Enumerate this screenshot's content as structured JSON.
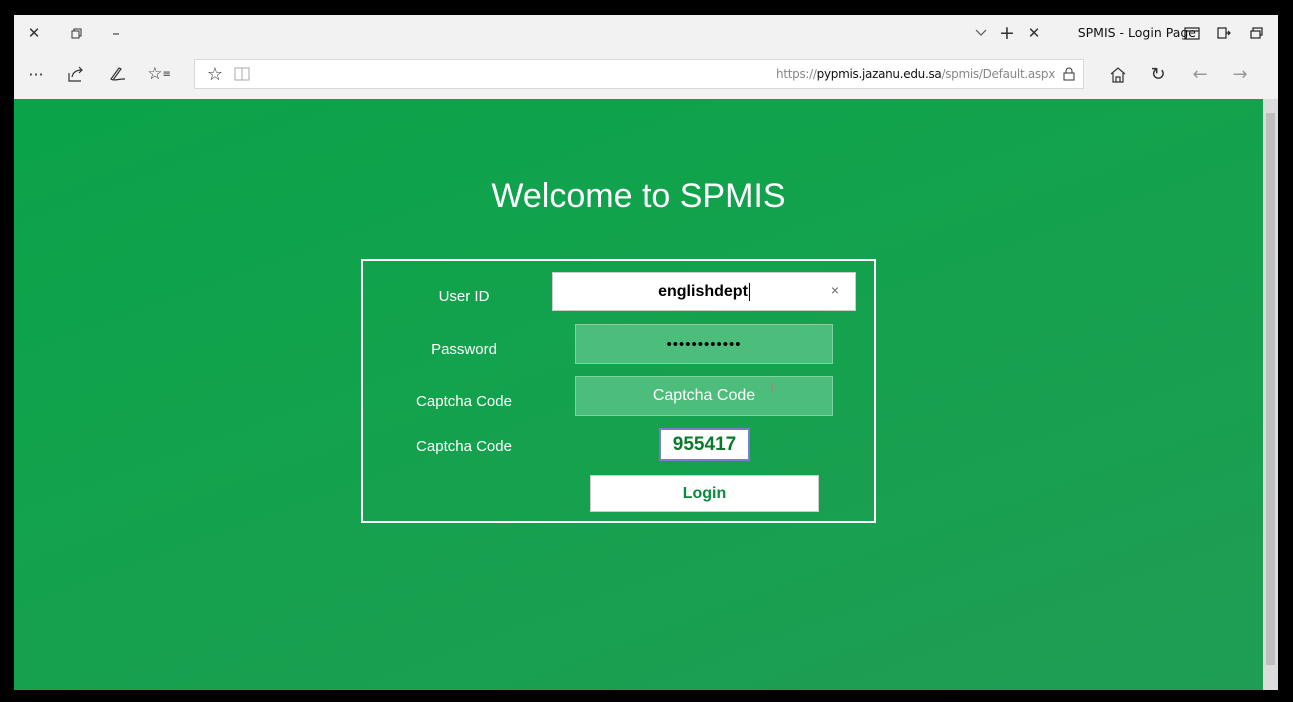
{
  "browser": {
    "tab_title": "SPMIS - Login Page",
    "url_prefix": "https://",
    "url_host": "pypmis.jazanu.edu.sa",
    "url_path": "/spmis/Default.aspx"
  },
  "page": {
    "heading": "Welcome to SPMIS",
    "form": {
      "userid_label": "User ID",
      "userid_value": "englishdept",
      "clear_glyph": "×",
      "password_label": "Password",
      "password_value": "••••••••••••",
      "captcha_input_label": "Captcha Code",
      "captcha_input_placeholder": "Captcha Code",
      "captcha_image_label": "Captcha Code",
      "captcha_value": "955417",
      "login_label": "Login"
    }
  },
  "colors": {
    "page_green": "#0aa34a",
    "accent_text": "#0a8a3a"
  },
  "icons": [
    "close-icon",
    "restore-icon",
    "minimize-icon",
    "more-icon",
    "share-icon",
    "pen-icon",
    "favorites-icon",
    "star-icon",
    "reading-view-icon",
    "lock-icon",
    "home-icon",
    "refresh-icon",
    "back-icon",
    "forward-icon",
    "tab-list-icon",
    "new-tab-icon",
    "tab-close-icon",
    "tabs-aside-icon",
    "set-aside-icon",
    "window-icon"
  ]
}
